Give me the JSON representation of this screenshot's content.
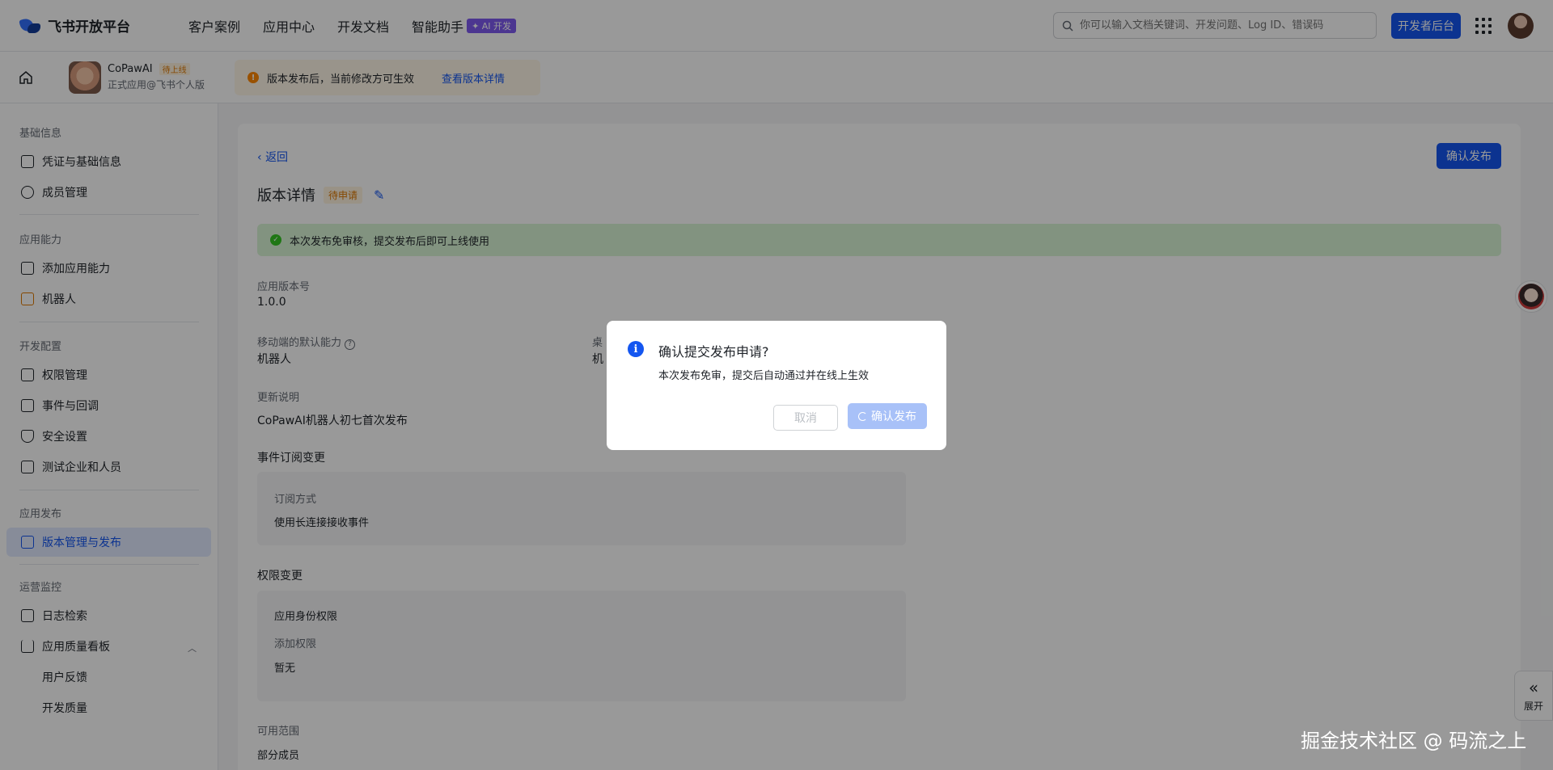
{
  "topnav": {
    "logo_text": "飞书开放平台",
    "links": [
      "客户案例",
      "应用中心",
      "开发文档",
      "智能助手"
    ],
    "ai_badge": "✦ AI 开发",
    "search_placeholder": "你可以输入文档关键词、开发问题、Log ID、错误码",
    "dev_button": "开发者后台"
  },
  "appbar": {
    "app_name": "CoPawAI",
    "app_status": "待上线",
    "app_sub": "正式应用@飞书个人版",
    "notice_text": "版本发布后，当前修改方可生效",
    "notice_link": "查看版本详情"
  },
  "sidebar": {
    "groups": [
      "基础信息",
      "应用能力",
      "开发配置",
      "应用发布",
      "运营监控"
    ],
    "items": [
      "凭证与基础信息",
      "成员管理",
      "添加应用能力",
      "机器人",
      "权限管理",
      "事件与回调",
      "安全设置",
      "测试企业和人员",
      "版本管理与发布",
      "日志检索",
      "应用质量看板",
      "用户反馈",
      "开发质量"
    ]
  },
  "main": {
    "back": "返回",
    "confirm_publish": "确认发布",
    "title": "版本详情",
    "title_tag": "待申请",
    "success_text": "本次发布免审核，提交发布后即可上线使用",
    "version_label": "应用版本号",
    "version_value": "1.0.0",
    "mobile_label": "移动端的默认能力",
    "mobile_value": "机器人",
    "desktop_label": "桌",
    "desktop_value": "机",
    "changelog_label": "更新说明",
    "changelog_value": "CoPawAI机器人初七首次发布",
    "event_label": "事件订阅变更",
    "event_box_label": "订阅方式",
    "event_box_value": "使用长连接接收事件",
    "perm_label": "权限变更",
    "perm_box_title": "应用身份权限",
    "perm_box_label": "添加权限",
    "perm_box_value": "暂无",
    "scope_label": "可用范围",
    "scope_value": "部分成员"
  },
  "modal": {
    "title": "确认提交发布申请?",
    "text": "本次发布免审，提交后自动通过并在线上生效",
    "cancel": "取消",
    "confirm": "确认发布"
  },
  "floating": {
    "expand_label": "展开",
    "watermark": "掘金技术社区 @ 码流之上"
  },
  "colors": {
    "primary": "#1456f0",
    "success_bg": "#d9f5d6",
    "warning": "#ff8800"
  }
}
